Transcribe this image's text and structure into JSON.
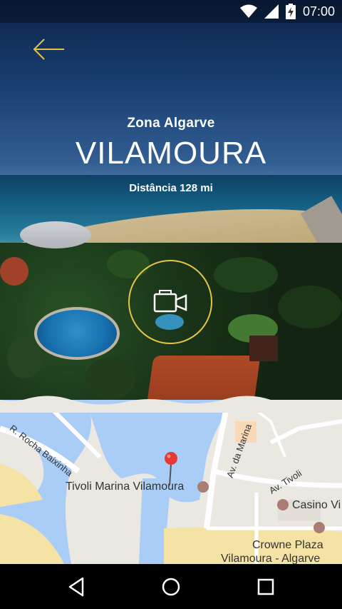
{
  "status_bar": {
    "time": "07:00",
    "icons": [
      "wifi-icon",
      "signal-icon",
      "battery-charging-icon"
    ]
  },
  "header": {
    "back_icon": "arrow-left-icon",
    "zone": "Zona Algarve",
    "title": "VILAMOURA",
    "distance_label": "Distância",
    "distance_value": "128 mi"
  },
  "video_button": {
    "icon": "video-camera-icon"
  },
  "map": {
    "labels": {
      "street_rocha": "R. Rocha Baixinha",
      "street_marina": "Av. da Marina",
      "street_tivoli": "Av. Tivoli",
      "poi_tivoli": "Tivoli Marina Vilamoura",
      "poi_casino": "Casino Vi",
      "poi_crowne_1": "Crowne Plaza",
      "poi_crowne_2": "Vilamoura - Algarve"
    },
    "pin_color": "#e53935"
  },
  "nav_bar": {
    "back_icon": "nav-back-icon",
    "home_icon": "nav-home-icon",
    "recents_icon": "nav-recents-icon"
  },
  "colors": {
    "accent": "#e5c445"
  }
}
